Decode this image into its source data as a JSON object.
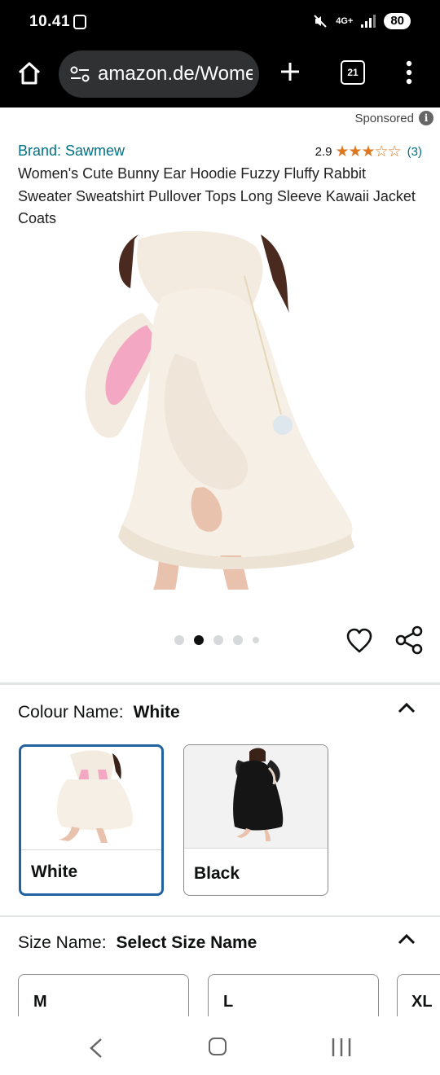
{
  "status": {
    "time": "10.41",
    "network": "4G+",
    "battery": "80"
  },
  "browser": {
    "url": "amazon.de/Wome",
    "tab_count": "21"
  },
  "sponsored": {
    "label": "Sponsored"
  },
  "product": {
    "brand": "Brand: Sawmew",
    "rating_value": "2.9",
    "rating_stars": 2.9,
    "rating_count": "(3)",
    "title": "Women's Cute Bunny Ear Hoodie Fuzzy Fluffy Rabbit Sweater Sweatshirt Pullover Tops Long Sleeve Kawaii Jacket Coats",
    "image_count": 5,
    "current_image": 2
  },
  "colour": {
    "label": "Colour Name:",
    "selected": "White",
    "options": [
      {
        "label": "White",
        "selected": true
      },
      {
        "label": "Black",
        "selected": false
      }
    ]
  },
  "size": {
    "label": "Size Name:",
    "selected": "Select Size Name",
    "options": [
      "M",
      "L",
      "XL"
    ]
  },
  "colors": {
    "link": "#007185",
    "star": "#de7921",
    "selected_border": "#2162a1"
  }
}
